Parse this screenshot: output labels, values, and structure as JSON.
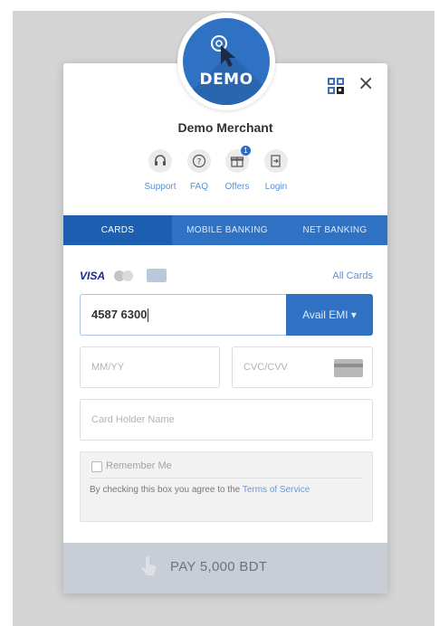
{
  "logo": {
    "text": "DEMO"
  },
  "merchant": {
    "name": "Demo Merchant"
  },
  "nav": {
    "support": "Support",
    "faq": "FAQ",
    "offers": "Offers",
    "offers_badge": "1",
    "login": "Login"
  },
  "tabs": [
    {
      "label": "CARDS",
      "active": true
    },
    {
      "label": "MOBILE BANKING",
      "active": false
    },
    {
      "label": "NET BANKING",
      "active": false
    }
  ],
  "card_brands": {
    "visa": "VISA"
  },
  "all_cards_link": "All Cards",
  "card_number": {
    "value": "4587 6300"
  },
  "emi_button": "Avail EMI ▾",
  "expiry": {
    "placeholder": "MM/YY"
  },
  "cvc": {
    "placeholder": "CVC/CVV"
  },
  "holder": {
    "placeholder": "Card Holder Name"
  },
  "remember": {
    "label": "Remember Me",
    "terms_prefix": "By checking this box you agree to the ",
    "terms_link": "Terms of Service"
  },
  "pay_button": {
    "label": "PAY 5,000 BDT"
  },
  "colors": {
    "primary": "#2f72c4",
    "tab_active": "#1c5fb0",
    "link": "#5b8fd3",
    "pay_bg": "#c9ced6"
  }
}
